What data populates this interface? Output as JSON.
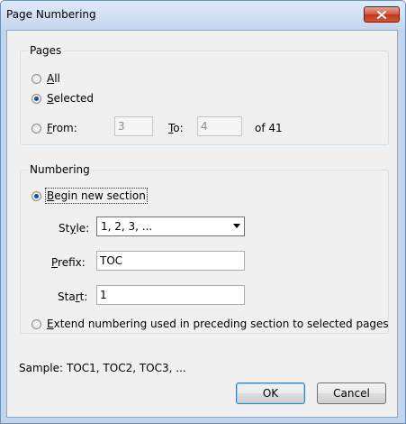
{
  "window": {
    "title": "Page Numbering"
  },
  "pages_group": {
    "legend": "Pages",
    "all": {
      "prefix": "",
      "mnemonic": "A",
      "rest": "ll",
      "checked": false
    },
    "selected": {
      "prefix": "",
      "mnemonic": "S",
      "rest": "elected",
      "checked": true
    },
    "from": {
      "mnemonic": "F",
      "rest": "rom:",
      "checked": false,
      "value": "3"
    },
    "to": {
      "mnemonic": "T",
      "rest": "o:",
      "value": "4"
    },
    "of_total": "of 41"
  },
  "numbering_group": {
    "legend": "Numbering",
    "begin_new": {
      "mnemonic": "B",
      "rest": "egin new section",
      "checked": true
    },
    "style": {
      "pre": "St",
      "mnemonic": "y",
      "post": "le:",
      "value": "1, 2, 3, ..."
    },
    "prefix": {
      "mnemonic": "P",
      "rest": "refix:",
      "value": "TOC"
    },
    "start": {
      "pre": "Sta",
      "mnemonic": "r",
      "post": "t:",
      "value": "1"
    },
    "extend": {
      "mnemonic": "E",
      "rest": "xtend numbering used in preceding section to selected pages",
      "checked": false
    }
  },
  "sample": {
    "label": "Sample:",
    "value": "TOC1, TOC2, TOC3, ..."
  },
  "buttons": {
    "ok": "OK",
    "cancel": "Cancel"
  }
}
